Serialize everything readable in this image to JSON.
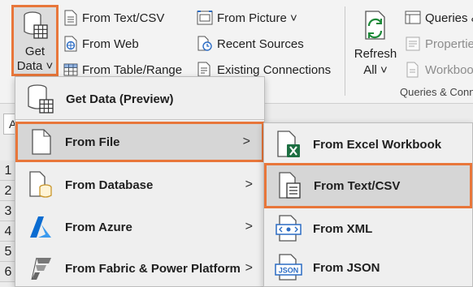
{
  "ribbon": {
    "get_data": {
      "line1": "Get",
      "line2": "Data ˅"
    },
    "col1": [
      {
        "label": "From Text/CSV",
        "icon": "text-csv-icon"
      },
      {
        "label": "From Web",
        "icon": "web-icon"
      },
      {
        "label": "From Table/Range",
        "icon": "table-icon"
      }
    ],
    "col2": [
      {
        "label": "From Picture ˅",
        "icon": "picture-icon"
      },
      {
        "label": "Recent Sources",
        "icon": "recent-sources-icon"
      },
      {
        "label": "Existing Connections",
        "icon": "existing-connections-icon"
      }
    ],
    "refresh": {
      "line1": "Refresh",
      "line2": "All ˅"
    },
    "col3": [
      {
        "label": "Queries &",
        "icon": "queries-icon"
      },
      {
        "label": "Properties",
        "icon": "properties-icon"
      },
      {
        "label": "Workbook",
        "icon": "workbook-links-icon"
      }
    ],
    "group_label": "Queries & Conn"
  },
  "sheet": {
    "name_box": "A",
    "rows": [
      "1",
      "2",
      "3",
      "4",
      "5",
      "6"
    ]
  },
  "get_data_menu": {
    "header": "Get Data (Preview)",
    "items": [
      {
        "label": "From File",
        "icon": "file-icon",
        "highlighted": true
      },
      {
        "label": "From Database",
        "icon": "database-icon"
      },
      {
        "label": "From Azure",
        "icon": "azure-icon"
      },
      {
        "label": "From Fabric & Power Platform",
        "icon": "fabric-icon"
      }
    ],
    "arrow": ">"
  },
  "from_file_submenu": {
    "items": [
      {
        "label": "From Excel Workbook",
        "icon": "excel-workbook-icon"
      },
      {
        "label": "From Text/CSV",
        "icon": "text-csv-icon",
        "highlighted": true
      },
      {
        "label": "From XML",
        "icon": "xml-icon"
      },
      {
        "label": "From JSON",
        "icon": "json-icon"
      }
    ]
  },
  "colors": {
    "highlight_border": "#e8763a",
    "excel_green": "#1d6f42",
    "azure_blue": "#0a6cd1"
  }
}
